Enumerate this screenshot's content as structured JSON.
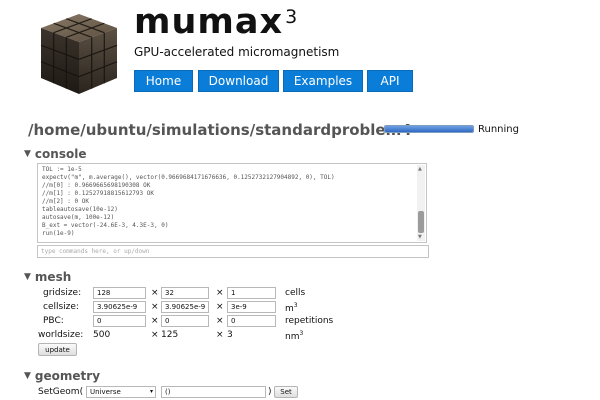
{
  "header": {
    "brand_name": "mumax",
    "brand_superscript": "3",
    "tagline": "GPU-accelerated micromagnetism",
    "logo_icon": "cube-logo-icon",
    "nav": [
      {
        "label": "Home"
      },
      {
        "label": "Download"
      },
      {
        "label": "Examples"
      },
      {
        "label": "API"
      }
    ],
    "accent_color": "#0a7dd8"
  },
  "sim": {
    "path": "/home/ubuntu/simulations/standardproblem4",
    "progress": 1.0,
    "status": "Running"
  },
  "console": {
    "title": "console",
    "lines": [
      "TOL := 1e-5",
      "expectv(\"m\", m.average(), vector(0.9669684171676636, 0.1252732127904892, 0), TOL)",
      "//m[0] : 0.9669665698190308 OK",
      "//m[1] : 0.12527918815612793 OK",
      "//m[2] : 0 OK",
      "tableautosave(10e-12)",
      "autosave(m, 100e-12)",
      "B_ext = vector(-24.6E-3, 4.3E-3, 0)",
      "run(1e-9)"
    ],
    "input_placeholder": "type commands here, or up/down"
  },
  "mesh": {
    "title": "mesh",
    "gridsize_label": "gridsize:",
    "gridsize": [
      "128",
      "32",
      "1"
    ],
    "gridsize_unit": "cells",
    "cellsize_label": "cellsize:",
    "cellsize": [
      "3.90625e-9",
      "3.90625e-9",
      "3e-9"
    ],
    "cellsize_unit": "m",
    "cellsize_unit_sup": "3",
    "pbc_label": "PBC:",
    "pbc": [
      "0",
      "0",
      "0"
    ],
    "pbc_unit": "repetitions",
    "worldsize_label": "worldsize:",
    "worldsize": [
      "500",
      "125",
      "3"
    ],
    "worldsize_unit": "nm",
    "worldsize_unit_sup": "3",
    "times": "×",
    "update_label": "update"
  },
  "geometry": {
    "title": "geometry",
    "setgeom_label": "SetGeom(",
    "shape_selected": "Universe",
    "args_value": "()",
    "close_paren": ")",
    "set_label": "Set"
  }
}
